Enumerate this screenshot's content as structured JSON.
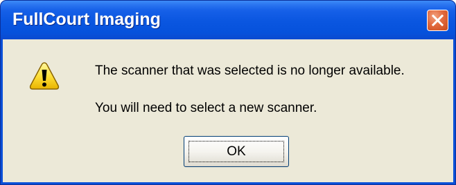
{
  "window": {
    "title": "FullCourt Imaging",
    "close_icon": "close-icon",
    "colors": {
      "title_bar": "#0a56e0",
      "client": "#ece9d8",
      "close_button": "#e26a3e"
    }
  },
  "dialog": {
    "icon": "warning-icon",
    "message_line_1": "The scanner that was selected is no longer available.",
    "message_line_2": "You will need to select a new scanner."
  },
  "buttons": {
    "ok_label": "OK"
  }
}
